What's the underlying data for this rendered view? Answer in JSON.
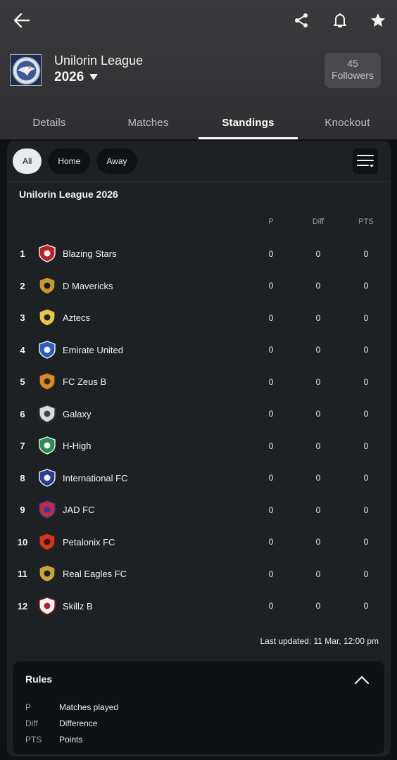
{
  "league": {
    "name": "Unilorin League",
    "season": "2026",
    "followers_count": "45",
    "followers_label": "Followers"
  },
  "tabs": [
    "Details",
    "Matches",
    "Standings",
    "Knockout"
  ],
  "active_tab": "Standings",
  "filters": [
    "All",
    "Home",
    "Away"
  ],
  "active_filter": "All",
  "table": {
    "title": "Unilorin League 2026",
    "columns": [
      "P",
      "Diff",
      "PTS"
    ],
    "rows": [
      {
        "rank": "1",
        "team": "Blazing Stars",
        "p": "0",
        "diff": "0",
        "pts": "0"
      },
      {
        "rank": "2",
        "team": "D Mavericks",
        "p": "0",
        "diff": "0",
        "pts": "0"
      },
      {
        "rank": "3",
        "team": "Aztecs",
        "p": "0",
        "diff": "0",
        "pts": "0"
      },
      {
        "rank": "4",
        "team": "Emirate United",
        "p": "0",
        "diff": "0",
        "pts": "0"
      },
      {
        "rank": "5",
        "team": "FC Zeus B",
        "p": "0",
        "diff": "0",
        "pts": "0"
      },
      {
        "rank": "6",
        "team": "Galaxy",
        "p": "0",
        "diff": "0",
        "pts": "0"
      },
      {
        "rank": "7",
        "team": "H-High",
        "p": "0",
        "diff": "0",
        "pts": "0"
      },
      {
        "rank": "8",
        "team": "International FC",
        "p": "0",
        "diff": "0",
        "pts": "0"
      },
      {
        "rank": "9",
        "team": "JAD FC",
        "p": "0",
        "diff": "0",
        "pts": "0"
      },
      {
        "rank": "10",
        "team": "Petalonix FC",
        "p": "0",
        "diff": "0",
        "pts": "0"
      },
      {
        "rank": "11",
        "team": "Real Eagles FC",
        "p": "0",
        "diff": "0",
        "pts": "0"
      },
      {
        "rank": "12",
        "team": "Skillz B",
        "p": "0",
        "diff": "0",
        "pts": "0"
      }
    ],
    "last_updated": "Last updated: 11 Mar, 12:00 pm"
  },
  "rules": {
    "title": "Rules",
    "items": [
      {
        "abbr": "P",
        "desc": "Matches played"
      },
      {
        "abbr": "Diff",
        "desc": "Difference"
      },
      {
        "abbr": "PTS",
        "desc": "Points"
      }
    ]
  },
  "icons": {
    "back": "back-arrow-icon",
    "share": "share-icon",
    "notify": "bell-icon",
    "favorite": "star-icon",
    "season_dropdown": "caret-down-icon",
    "sort_menu": "sort-menu-icon",
    "collapse": "chevron-up-icon"
  },
  "colors": {
    "header_bg": "#333335",
    "page_bg": "#0f1214",
    "card_bg": "#1d2124",
    "active_indicator": "#ffffff",
    "followers_bg": "#4a4a4c"
  }
}
